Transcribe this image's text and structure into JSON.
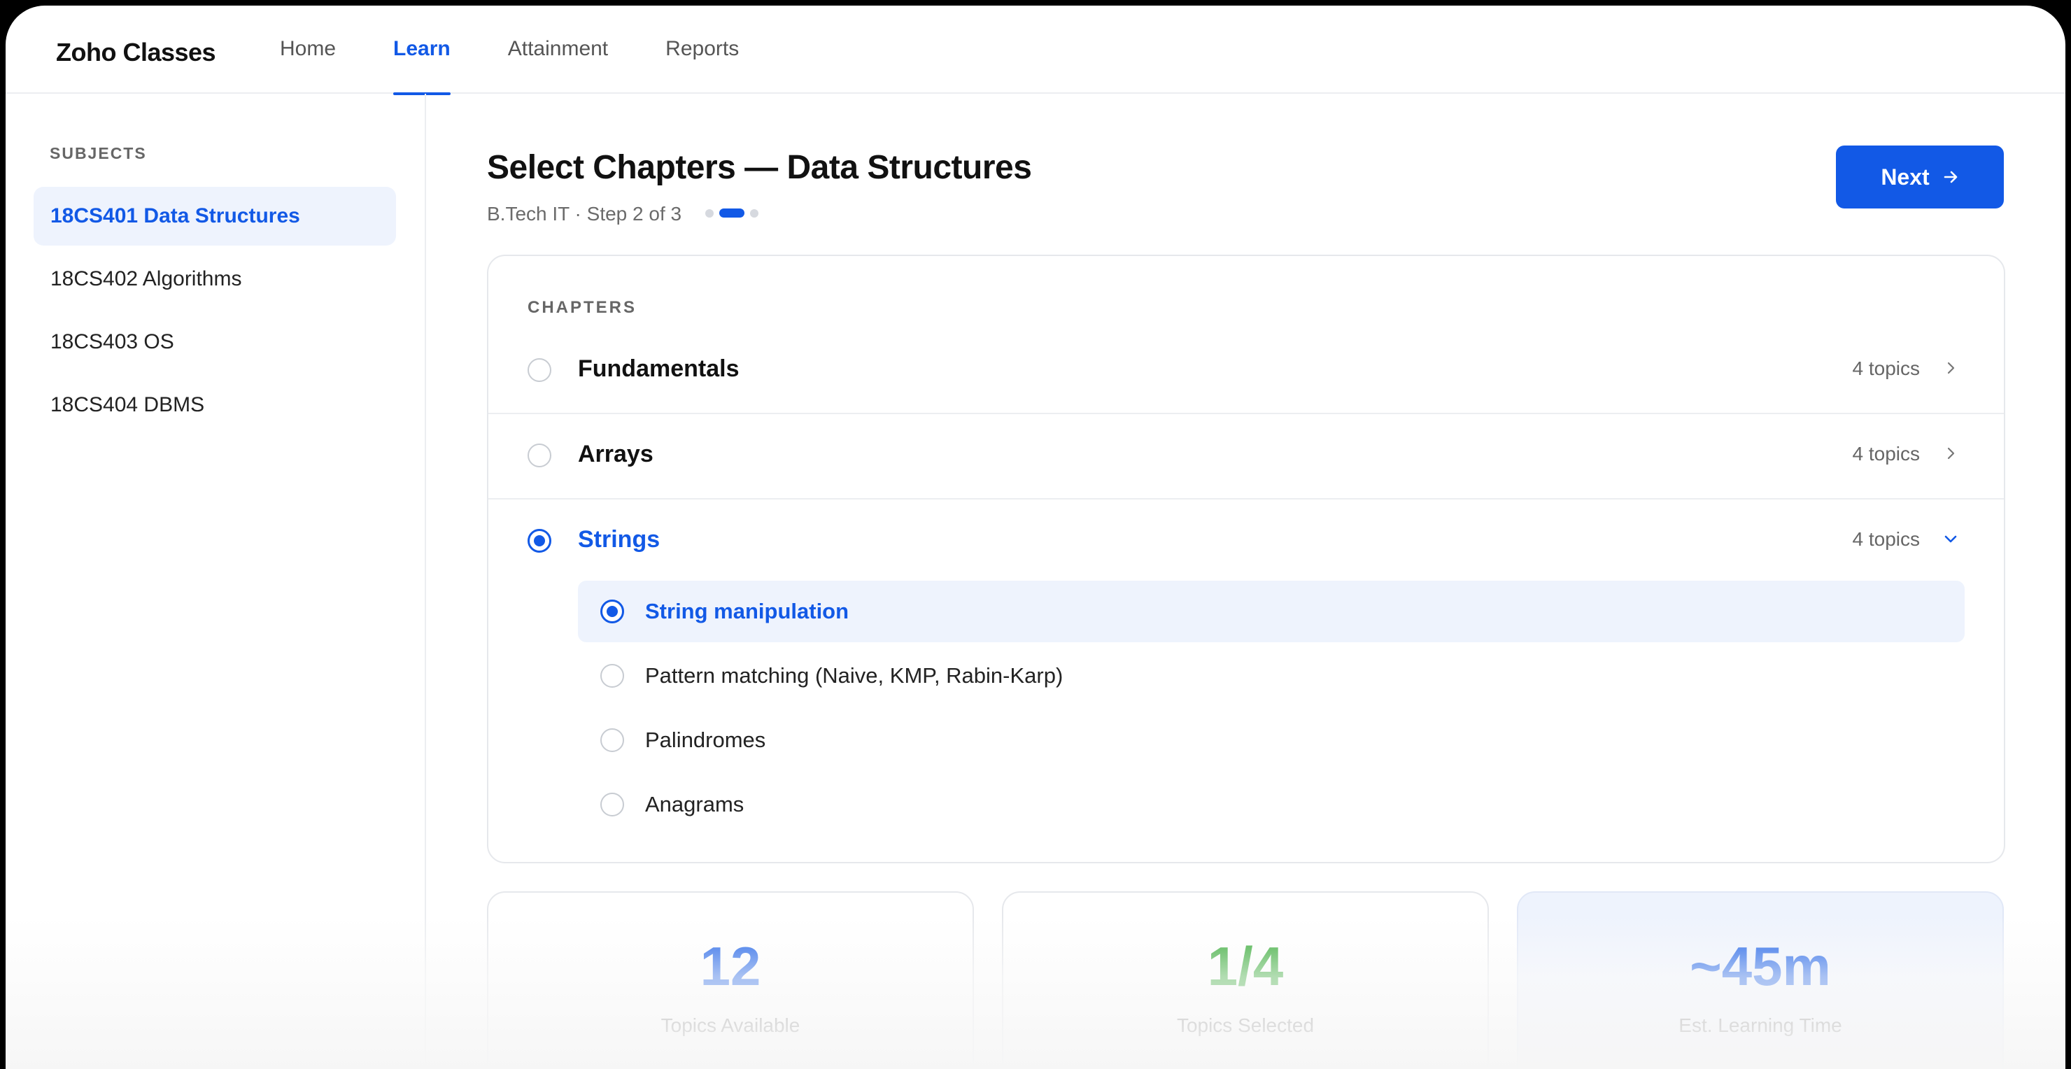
{
  "app": {
    "brand": "Zoho Classes"
  },
  "nav": [
    {
      "label": "Home",
      "active": false
    },
    {
      "label": "Learn",
      "active": true
    },
    {
      "label": "Attainment",
      "active": false
    },
    {
      "label": "Reports",
      "active": false
    }
  ],
  "sidebar": {
    "heading": "SUBJECTS",
    "items": [
      {
        "label": "18CS401 Data Structures",
        "active": true
      },
      {
        "label": "18CS402 Algorithms",
        "active": false
      },
      {
        "label": "18CS403 OS",
        "active": false
      },
      {
        "label": "18CS404 DBMS",
        "active": false
      }
    ]
  },
  "header": {
    "title": "Select Chapters — Data Structures",
    "subtitle": "B.Tech IT · Step 2 of 3",
    "step_current": 2,
    "step_total": 3,
    "next_label": "Next"
  },
  "chapters": {
    "heading": "CHAPTERS",
    "items": [
      {
        "label": "Fundamentals",
        "count": "4 topics",
        "selected": false,
        "expanded": false
      },
      {
        "label": "Arrays",
        "count": "4 topics",
        "selected": false,
        "expanded": false
      },
      {
        "label": "Strings",
        "count": "4 topics",
        "selected": true,
        "expanded": true,
        "topics": [
          {
            "label": "String manipulation",
            "selected": true
          },
          {
            "label": "Pattern matching (Naive, KMP, Rabin-Karp)",
            "selected": false
          },
          {
            "label": "Palindromes",
            "selected": false
          },
          {
            "label": "Anagrams",
            "selected": false
          }
        ]
      }
    ]
  },
  "stats": [
    {
      "value": "12",
      "label": "Topics Available",
      "color": "#1259e6"
    },
    {
      "value": "1/4",
      "label": "Topics Selected",
      "color": "#2aa52a"
    },
    {
      "value": "~45m",
      "label": "Est. Learning Time",
      "color": "#1259e6"
    }
  ],
  "colors": {
    "accent": "#1259e6",
    "success": "#2aa52a",
    "selected_bg": "#eef3fd"
  }
}
